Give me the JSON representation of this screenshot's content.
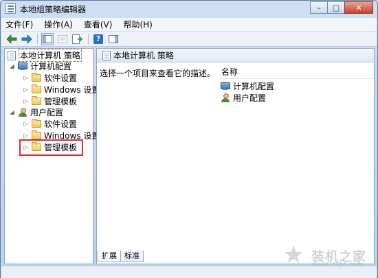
{
  "window": {
    "title": "本地组策略编辑器",
    "minimize_glyph": "–",
    "maximize_glyph": "□",
    "close_glyph": "✕"
  },
  "menu": [
    "文件(F)",
    "操作(A)",
    "查看(V)",
    "帮助(H)"
  ],
  "toolbar": {
    "icons": [
      "back-arrow-icon",
      "forward-arrow-icon",
      "show-hide-tree-icon",
      "properties-icon",
      "export-list-icon",
      "help-icon",
      "show-hide-action-pane-icon"
    ],
    "help_glyph": "?"
  },
  "tree": {
    "root": "本地计算机 策略",
    "computer_config": "计算机配置",
    "computer_children": [
      "软件设置",
      "Windows 设置",
      "管理模板"
    ],
    "user_config": "用户配置",
    "user_children": [
      "软件设置",
      "Windows 设置",
      "管理模板"
    ]
  },
  "right_pane": {
    "header": "本地计算机 策略",
    "description": "选择一个项目来查看它的描述。",
    "column_name": "名称",
    "items": [
      "计算机配置",
      "用户配置"
    ]
  },
  "tabs": [
    "扩展",
    "标准"
  ],
  "watermark": {
    "text": "装机之家",
    "url": "www.lotpc.com"
  },
  "colors": {
    "highlight_border": "#e0282e",
    "accent": "#2a6bd0"
  }
}
